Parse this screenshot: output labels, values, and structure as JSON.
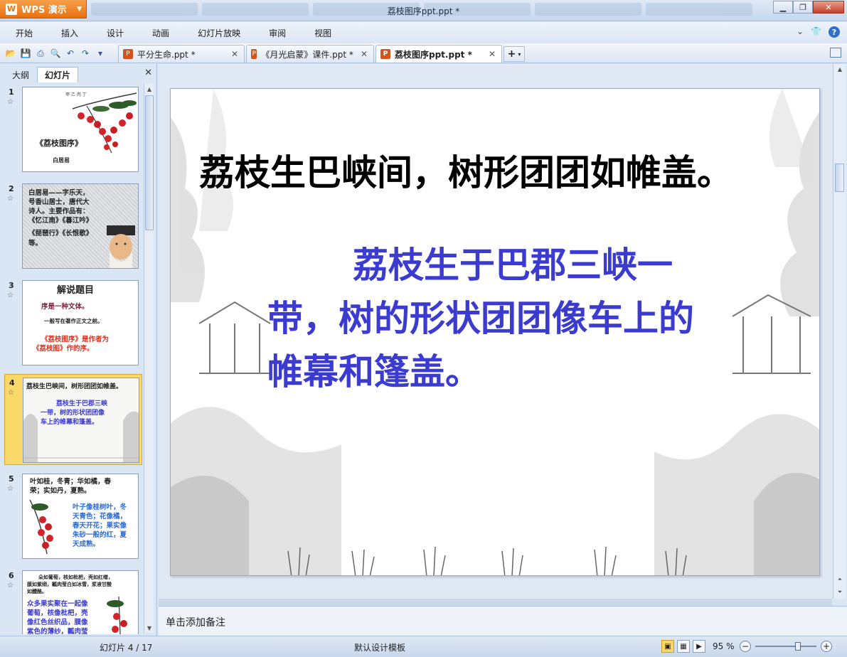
{
  "app": {
    "name": "WPS 演示",
    "window_title": "荔枝图序ppt.ppt *"
  },
  "menu": [
    "开始",
    "插入",
    "设计",
    "动画",
    "幻灯片放映",
    "审阅",
    "视图"
  ],
  "doc_tabs": [
    {
      "label": "平分生命.ppt *",
      "active": false
    },
    {
      "label": "《月光启蒙》课件.ppt *",
      "active": false
    },
    {
      "label": "荔枝图序ppt.ppt *",
      "active": true
    }
  ],
  "left_pane": {
    "tabs": [
      "大纲",
      "幻灯片"
    ],
    "active_tab": "幻灯片",
    "slides": [
      {
        "num": "1",
        "lines": [
          "《荔枝图序》",
          "白居易"
        ]
      },
      {
        "num": "2",
        "lines": [
          "白居易——字乐天，",
          "号香山居士，唐代大",
          "诗人。主要作品有：",
          "《忆江南》《暮江吟》",
          "《琵琶行》《长恨歌》",
          "等。"
        ]
      },
      {
        "num": "3",
        "lines": [
          "解说题目",
          "序是一种文体。",
          "一般写在著作正文之前。",
          "《荔枝图序》是作者为",
          "《荔枝图》作的序。"
        ]
      },
      {
        "num": "4",
        "lines": [
          "荔枝生巴峡间，树形团团如帷盖。",
          "荔枝生于巴郡三峡",
          "一带，树的形状团团像",
          "车上的帷幕和篷盖。"
        ]
      },
      {
        "num": "5",
        "lines": [
          "叶如桂，冬青；华如橘，春",
          "荣；实如丹，夏熟。",
          "叶子像桂树叶，冬",
          "天青色；花像橘，",
          "春天开花；果实像",
          "朱砂一般的红，夏",
          "天成熟。"
        ]
      },
      {
        "num": "6",
        "lines": [
          "朵如葡萄，核如枇杷，壳如红缯，",
          "膜如紫绡，瓤肉莹白如冰雪，浆液甘酸",
          "如醴酪。",
          "众多果实聚在一起像",
          "葡萄，核像枇杷，壳",
          "像红色丝织品，膜像",
          "紫色的薄纱，瓤肉莹"
        ]
      }
    ]
  },
  "slide": {
    "title": "荔枝生巴峡间，树形团团如帷盖。",
    "body": "荔枝生于巴郡三峡一带，树的形状团团像车上的帷幕和篷盖。",
    "title_color": "#000000",
    "body_color": "#3b3bd0"
  },
  "notes_placeholder": "单击添加备注",
  "status": {
    "slide_counter": "幻灯片 4 / 17",
    "template": "默认设计模板",
    "zoom": "95 %",
    "zoom_level_fraction": 0.7
  },
  "icons": {
    "quick_access": [
      "open-icon",
      "save-icon",
      "print-icon",
      "print-preview-icon",
      "undo-icon",
      "redo-icon",
      "customize-icon"
    ]
  },
  "colors": {
    "app_orange": "#e8710f",
    "selection_yellow": "#fbd86a"
  }
}
